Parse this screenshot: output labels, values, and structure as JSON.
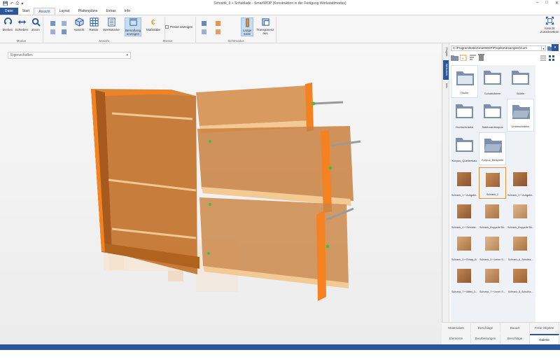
{
  "window": {
    "title": "Schrank_3 + Schublade - SmartWOP (Konstruktion in der Fertigung Werkstattmodus)"
  },
  "ribbon": {
    "tabs": [
      "Datei",
      "Start",
      "Ansicht",
      "Layout",
      "Plattenpläne",
      "Extras",
      "Info"
    ],
    "active_tab": "Ansicht",
    "groups": {
      "modus": {
        "label": "Modus",
        "buttons": [
          "Drehen",
          "Schieben",
          "Zoom"
        ]
      },
      "ansicht": {
        "label": "Ansicht",
        "buttons": [
          "Ansicht",
          "Raster",
          "Werkstücke",
          "Bemaßung anzeigen"
        ]
      },
      "presse": {
        "label": "Presse",
        "buttons": [
          "Maßstäbe"
        ],
        "checkbox": "Preise anzeigen"
      },
      "sichtmodus": {
        "label": "Sichtmodus",
        "buttons": [
          "Lange Seite",
          "Transparenz aus"
        ]
      },
      "extra": {
        "buttons": [
          "Ansicht zurücksetzen"
        ]
      }
    }
  },
  "viewport": {
    "properties_dropdown": "Eigenschaften"
  },
  "panel": {
    "vertical_tabs": [
      "Projekt",
      "Bibliothek",
      "Info"
    ],
    "active_vtab": "Bibliothek",
    "path": "C:\\ProgramData\\SmartWOP\\Projekte\\Examples\\Com",
    "folders": [
      {
        "name": "Tische"
      },
      {
        "name": "Schubkästen"
      },
      {
        "name": "Stühle"
      },
      {
        "name": "Hochschränke"
      },
      {
        "name": "Sideboardkorpus"
      },
      {
        "name": "Unterschränke"
      },
      {
        "name": "Korpus_Quellensatz"
      },
      {
        "name": "Korpus_Beispiele"
      }
    ],
    "thumbnails": [
      {
        "name": "Schrank_1 + Ausgabe..."
      },
      {
        "name": "Schrank_2"
      },
      {
        "name": "Schrank_3 + Ausgabe..."
      },
      {
        "name": "Schrank_4 + Schubla..."
      },
      {
        "name": "Schrank_Doppelte Bo..."
      },
      {
        "name": "Schrank_Doppelte Bo..."
      },
      {
        "name": "Schrank_3 + Einlag_B..."
      },
      {
        "name": "Schrank_5 + Innen S..."
      },
      {
        "name": "Schrank_6_Schubla..."
      },
      {
        "name": "Schrank_7 + Mittel_3..."
      },
      {
        "name": "Schrank_7 + Innen S..."
      },
      {
        "name": "Schrank_8_Schubla..."
      }
    ],
    "bottom_tabs_row1": [
      "Materialien",
      "Beschläge",
      "Bauart",
      "Freie Objekte"
    ],
    "bottom_tabs_row2": [
      "Elemente",
      "Bearbeitungen",
      "Beschläge",
      "Galerie"
    ],
    "active_bottom_tab": "Galerie"
  },
  "colors": {
    "accent": "#2b579a",
    "wood_light": "#e9a04f",
    "wood_dark": "#a55a1f",
    "panel_edge": "#f58220",
    "folder": "#7e8fab"
  }
}
